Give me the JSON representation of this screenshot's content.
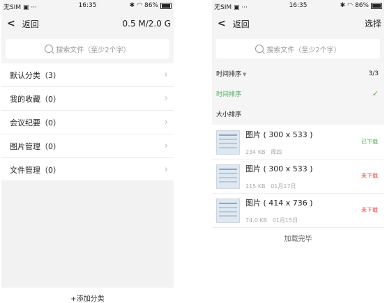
{
  "left": {
    "status": {
      "carrier": "无SIM",
      "time": "16:35",
      "battery": "86%"
    },
    "nav": {
      "back": "返回",
      "right": "0.5 M/2.0 G"
    },
    "search": {
      "placeholder": "搜索文件（至少2个字）"
    },
    "categories": [
      {
        "label": "默认分类（3）"
      },
      {
        "label": "我的收藏（0）"
      },
      {
        "label": "会议纪要（0）"
      },
      {
        "label": "图片管理（0）"
      },
      {
        "label": "文件管理（0）"
      }
    ],
    "add_category": "+添加分类"
  },
  "right": {
    "status": {
      "carrier": "无SIM",
      "time": "16:35",
      "battery": "86%"
    },
    "nav": {
      "back": "返回",
      "right": "选择"
    },
    "search": {
      "placeholder": "搜索文件（至少2个字）"
    },
    "sort": {
      "header": "时间排序",
      "count": "3/3",
      "option_time": "时间排序",
      "option_size": "大小排序"
    },
    "files": [
      {
        "name": "图片 ( 300 x 533 )",
        "size": "234 KB",
        "date": "周四",
        "status": "已下载"
      },
      {
        "name": "图片 ( 300 x 533 )",
        "size": "115 KB",
        "date": "01月17日",
        "status": "未下载"
      },
      {
        "name": "图片 ( 414 x 736 )",
        "size": "74.0 KB",
        "date": "01月15日",
        "status": "未下载"
      }
    ],
    "loaded": "加载完毕"
  },
  "colors": {
    "accent_green": "#4cae5a",
    "status_red": "#e04a3f"
  }
}
